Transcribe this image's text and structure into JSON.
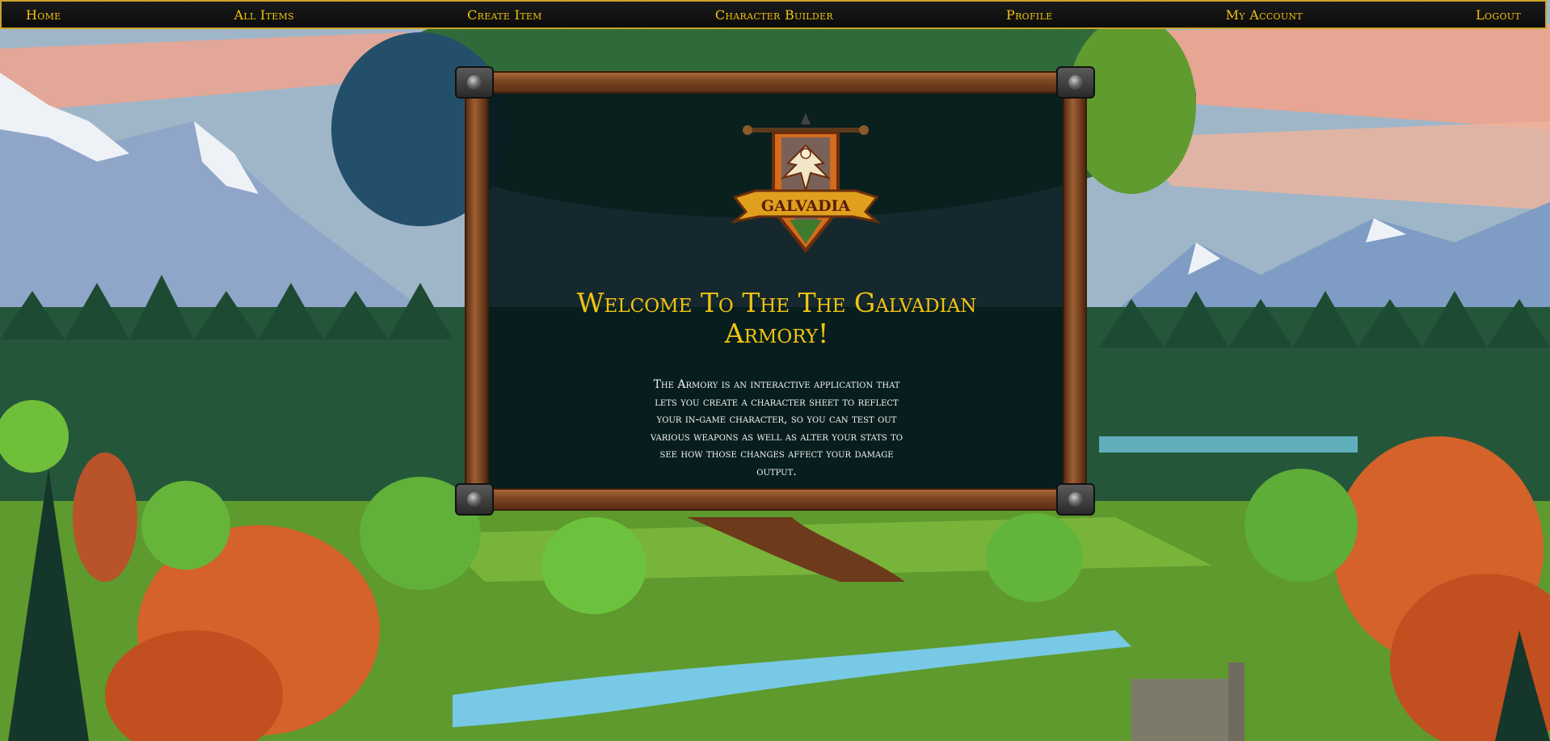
{
  "nav": {
    "items": [
      {
        "label": "Home"
      },
      {
        "label": "All Items"
      },
      {
        "label": "Create Item"
      },
      {
        "label": "Character Builder"
      },
      {
        "label": "Profile"
      },
      {
        "label": "My Account"
      },
      {
        "label": "Logout"
      }
    ]
  },
  "main": {
    "title": "Welcome To The The Galvadian Armory!",
    "description": "The Armory is an interactive application that lets you create a character sheet to reflect your in-game character, so you can test out various weapons as well as alter your stats to see how those changes affect your damage output."
  },
  "logo": {
    "text": "GALVADIA",
    "icon": "eagle-crest-icon"
  },
  "colors": {
    "accent": "#f1c40f",
    "nav_border": "#c9a227",
    "panel_bg": "#06181c",
    "frame_wood": "#7a4421"
  }
}
